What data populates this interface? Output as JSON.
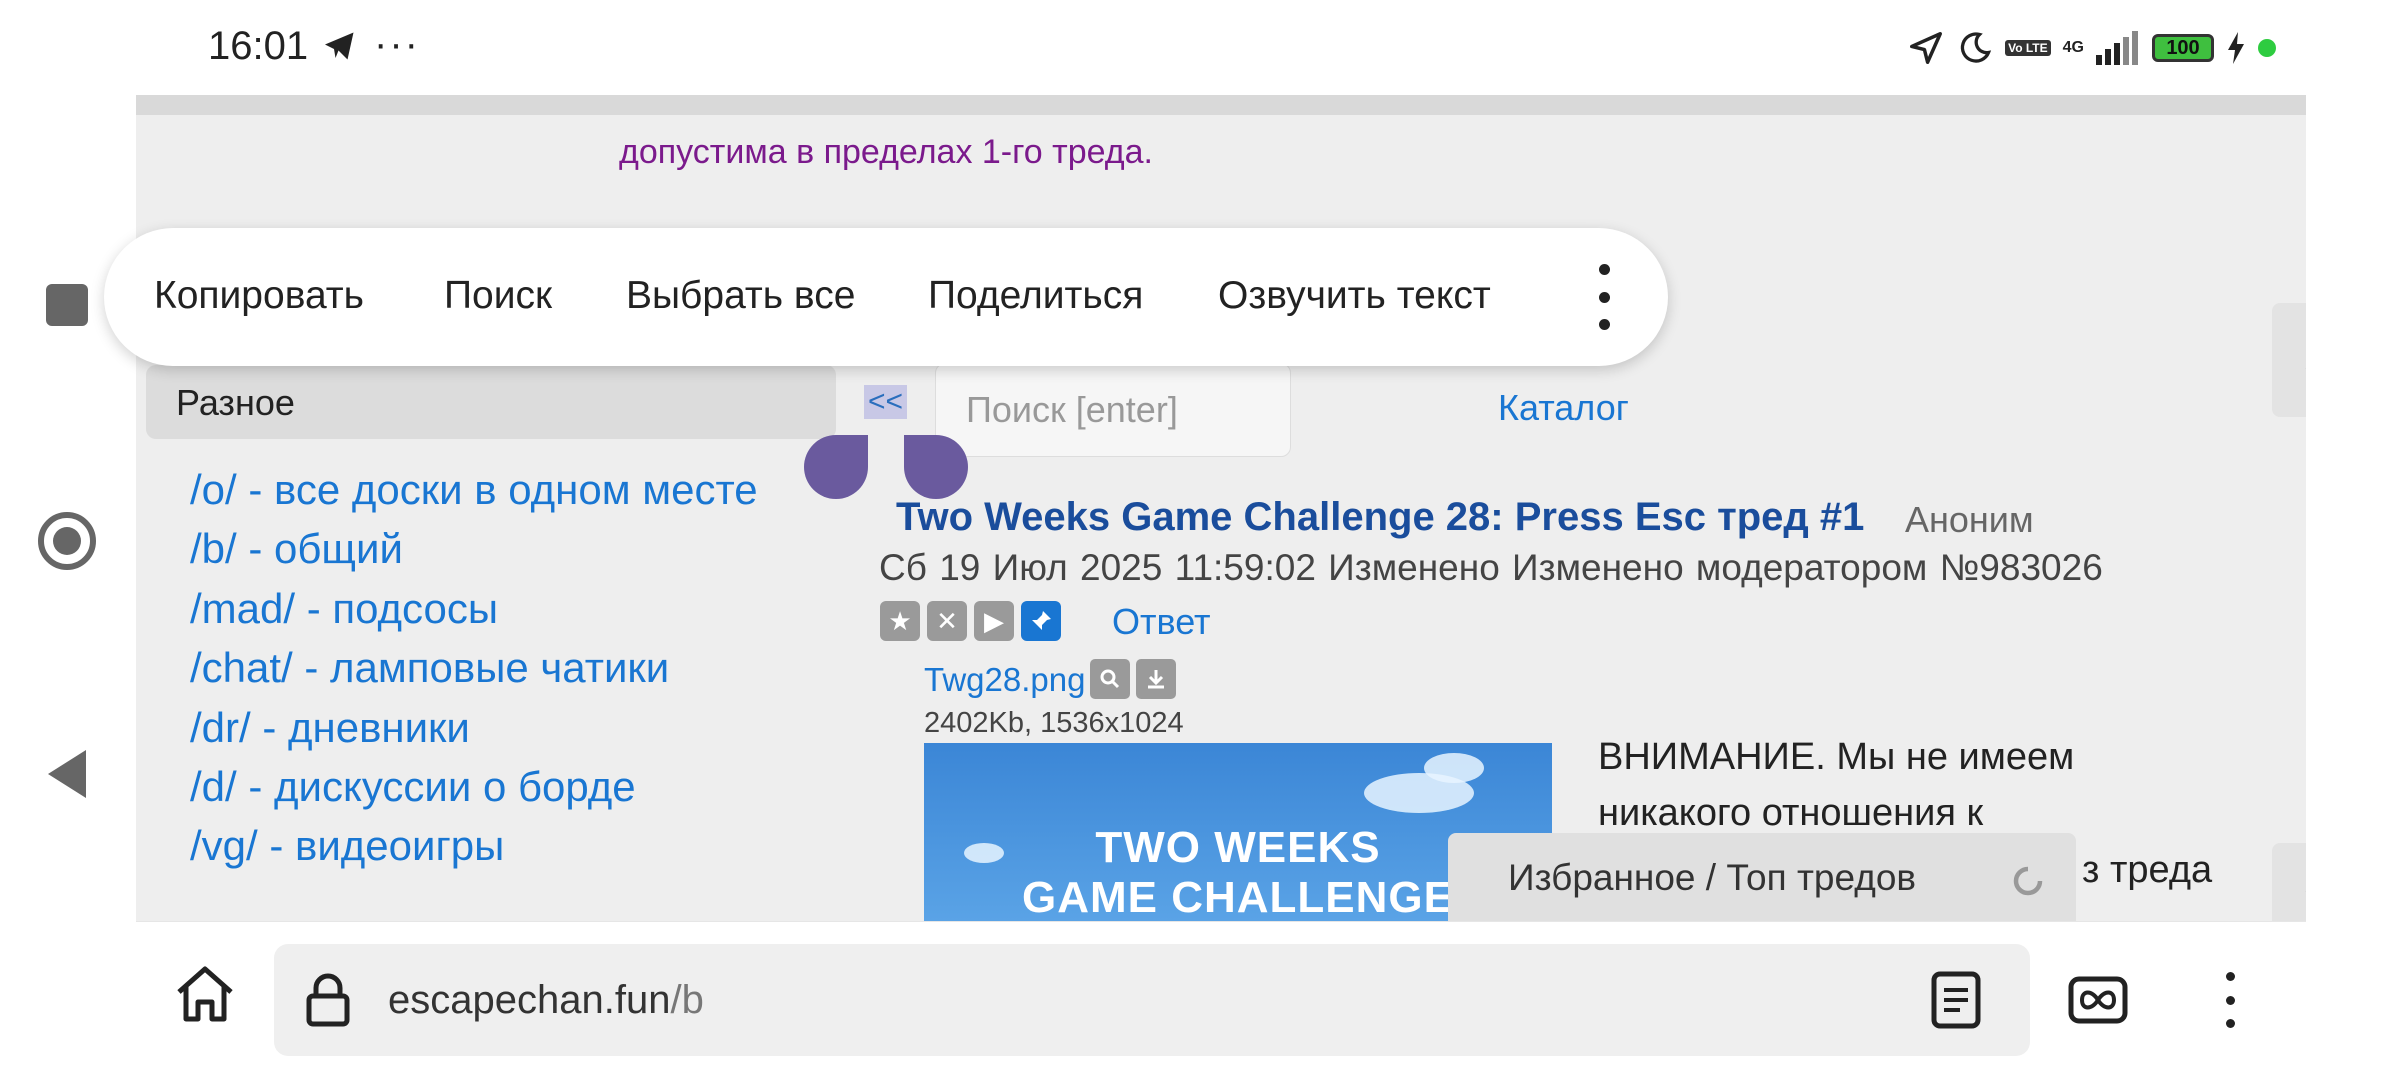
{
  "status_bar": {
    "time": "16:01",
    "volte_label": "Vo LTE",
    "network_label": "4G",
    "battery_level": "100"
  },
  "page": {
    "notice": "допустима в пределах 1-го треда.",
    "sidebar": {
      "category": "Разное",
      "collapse_label": "<<",
      "boards": [
        "/o/ - все доски в одном месте",
        "/b/ - общий",
        "/mad/ - подсосы",
        "/chat/ - ламповые чатики",
        "/dr/ - дневники",
        "/d/ - дискуссии о борде",
        "/vg/ - видеоигры"
      ]
    },
    "search": {
      "placeholder": "Поиск [enter]"
    },
    "catalog_link": "Каталог",
    "thread": {
      "title": "Two Weeks Game Challenge 28: Press Esc тред #1",
      "author": "Аноним",
      "meta": "Сб 19 Июл 2025 11:59:02  Изменено  Изменено модератором  №983026",
      "reply_label": "Ответ",
      "file_name": "Twg28.png",
      "file_info": "2402Kb, 1536x1024",
      "image_text_line1": "TWO WEEKS",
      "image_text_line2": "GAME CHALLENGE",
      "body": "ВНИМАНИЕ. Мы не имеем никакого отношения к",
      "body_tail": "з треда"
    },
    "favorites_label": "Избранное / Топ тредов"
  },
  "selection_menu": {
    "items": [
      "Копировать",
      "Поиск",
      "Выбрать все",
      "Поделиться",
      "Озвучить текст"
    ]
  },
  "browser": {
    "url_domain": "escapechan.fun",
    "url_path": "/b"
  },
  "colors": {
    "link": "#1976d2",
    "title": "#1a4d9c",
    "notice": "#7b1a8c",
    "selection_handle": "#6a5a9e"
  }
}
